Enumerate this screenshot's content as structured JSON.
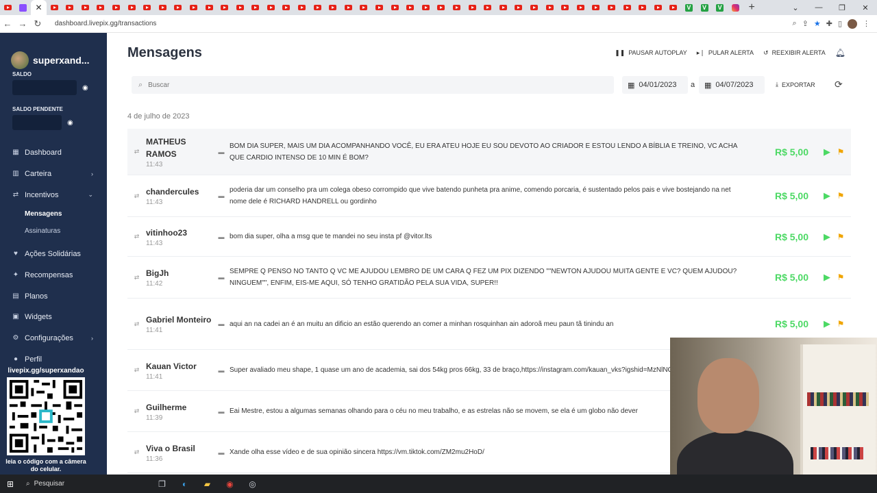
{
  "browser": {
    "url": "dashboard.livepix.gg/transactions",
    "tab_count_youtube": 44
  },
  "sidebar": {
    "username": "superxand...",
    "saldo_label": "SALDO",
    "saldo_pendente_label": "SALDO PENDENTE",
    "menu": [
      {
        "label": "Dashboard",
        "icon": "dashboard-icon"
      },
      {
        "label": "Carteira",
        "icon": "wallet-icon",
        "chevron": "›"
      },
      {
        "label": "Incentivos",
        "icon": "arrows-icon",
        "chevron": "⌄"
      }
    ],
    "submenu": [
      {
        "label": "Mensagens",
        "active": true
      },
      {
        "label": "Assinaturas",
        "active": false
      }
    ],
    "menu2": [
      {
        "label": "Ações Solidárias",
        "icon": "solidarity-icon"
      },
      {
        "label": "Recompensas",
        "icon": "gift-icon"
      },
      {
        "label": "Planos",
        "icon": "plans-icon"
      },
      {
        "label": "Widgets",
        "icon": "widgets-icon"
      },
      {
        "label": "Configurações",
        "icon": "gear-icon",
        "chevron": "›"
      },
      {
        "label": "Perfil",
        "icon": "profile-icon"
      }
    ],
    "qr_url": "livepix.gg/superxandao",
    "qr_note": "leia o código com a câmera do celular."
  },
  "header": {
    "title": "Mensagens",
    "actions": [
      {
        "label": "PAUSAR AUTOPLAY",
        "icon": "pause-icon"
      },
      {
        "label": "PULAR ALERTA",
        "icon": "skip-icon"
      },
      {
        "label": "REEXIBIR ALERTA",
        "icon": "replay-icon"
      }
    ]
  },
  "filters": {
    "search_placeholder": "Buscar",
    "date_from": "04/01/2023",
    "date_sep": "a",
    "date_to": "04/07/2023",
    "export_label": "EXPORTAR"
  },
  "section_date": "4 de julho de 2023",
  "messages": [
    {
      "name": "MATHEUS RAMOS",
      "time": "11:43",
      "text": "BOM DIA SUPER, MAIS UM DIA ACOMPANHANDO VOCÊ, EU ERA ATEU HOJE EU SOU DEVOTO AO CRIADOR E ESTOU LENDO A BÍBLIA E TREINO, VC ACHA QUE CARDIO INTENSO DE 10 MIN É BOM?",
      "amount": "R$ 5,00"
    },
    {
      "name": "chandercules",
      "time": "11:43",
      "text": "poderia dar um conselho pra um colega obeso corrompido que vive batendo punheta pra anime, comendo porcaria, é sustentado pelos pais e vive bostejando na net nome dele é RICHARD HANDRELL ou gordinho",
      "amount": "R$ 5,00"
    },
    {
      "name": "vitinhoo23",
      "time": "11:43",
      "text": "bom dia super, olha a msg que te mandei no seu insta pf @vitor.lts",
      "amount": "R$ 5,00"
    },
    {
      "name": "BigJh",
      "time": "11:42",
      "text": "SEMPRE Q PENSO NO TANTO Q VC ME AJUDOU LEMBRO DE UM CARA Q FEZ UM PIX DIZENDO \"\"NEWTON AJUDOU MUITA GENTE E VC? QUEM AJUDOU? NINGUEM\"\", ENFIM, EIS-ME AQUI, SÓ TENHO GRATIDÃO PELA SUA VIDA, SUPER!!",
      "amount": "R$ 5,00"
    },
    {
      "name": "Gabriel Monteiro",
      "time": "11:41",
      "text": "aqui an na cadei an é an muitu an dificio an estão querendo an comer a minhan rosquinhan ain adoroã meu paun tã tinindu an",
      "amount": "R$ 5,00"
    },
    {
      "name": "Kauan Victor",
      "time": "11:41",
      "text": "Super avaliado meu shape, 1 quase um ano de academia, sai dos 54kg pros 66kg, 33 de braço,https://instagram.com/kauan_vks?igshid=MzNlNGNkZWQ4Mg==",
      "amount": ""
    },
    {
      "name": "Guilherme",
      "time": "11:39",
      "text": "Eai Mestre, estou a algumas semanas olhando para o céu no meu trabalho, e as estrelas não se movem, se ela é um globo não dever",
      "amount": ""
    },
    {
      "name": "Viva o Brasil",
      "time": "11:36",
      "text": "Xande olha esse vídeo e de sua opinião sincera https://vm.tiktok.com/ZM2mu2HoD/",
      "amount": ""
    }
  ],
  "taskbar": {
    "search_label": "Pesquisar"
  },
  "colors": {
    "sidebar_bg": "#1f2f4d",
    "amount_green": "#4cd964",
    "flag_orange": "#f0a500"
  }
}
